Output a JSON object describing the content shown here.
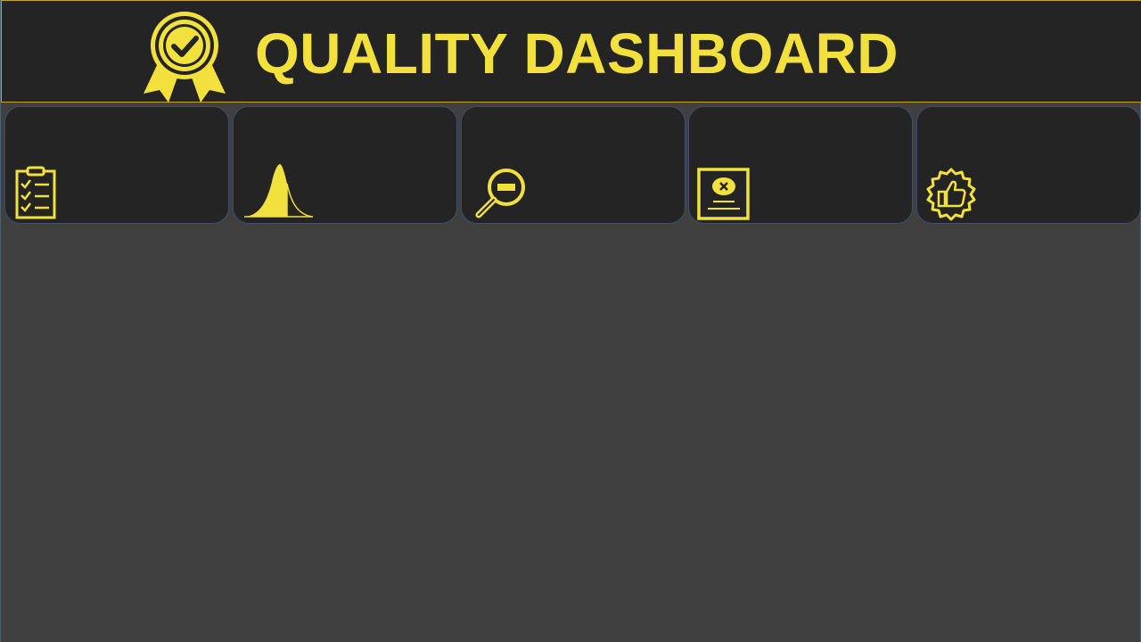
{
  "header": {
    "title": "QUALITY DASHBOARD",
    "logo_icon": "award-ribbon-check-icon",
    "accent_color": "#f2e13c",
    "background_color": "#242424"
  },
  "cards": [
    {
      "icon": "clipboard-checklist-icon"
    },
    {
      "icon": "bell-curve-icon"
    },
    {
      "icon": "magnifier-minus-icon"
    },
    {
      "icon": "rejected-document-icon"
    },
    {
      "icon": "thumbs-up-badge-icon"
    }
  ],
  "colors": {
    "page_background": "#404040",
    "card_background": "#242424",
    "card_border": "#3b4f6a",
    "header_border": "#c9a227"
  }
}
